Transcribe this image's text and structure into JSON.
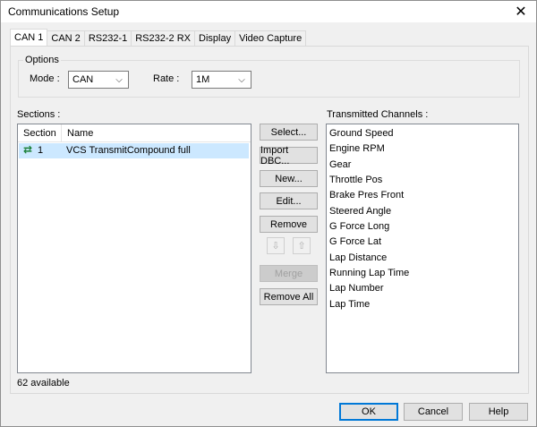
{
  "window": {
    "title": "Communications Setup",
    "close_glyph": "✕"
  },
  "tabs": [
    {
      "label": "CAN 1",
      "active": true
    },
    {
      "label": "CAN 2"
    },
    {
      "label": "RS232-1"
    },
    {
      "label": "RS232-2 RX"
    },
    {
      "label": "Display"
    },
    {
      "label": "Video Capture"
    }
  ],
  "options": {
    "legend": "Options",
    "mode_label": "Mode :",
    "mode_value": "CAN",
    "rate_label": "Rate :",
    "rate_value": "1M"
  },
  "sections": {
    "label": "Sections :",
    "columns": [
      "Section",
      "Name"
    ],
    "rows": [
      {
        "icon": "transmit-arrows-icon",
        "section": "1",
        "name": "VCS TransmitCompound full"
      }
    ],
    "footer": "62 available"
  },
  "actions": {
    "select": "Select...",
    "import": "Import DBC...",
    "new": "New...",
    "edit": "Edit...",
    "remove": "Remove",
    "move_down_glyph": "⇩",
    "move_up_glyph": "⇧",
    "merge": "Merge",
    "remove_all": "Remove All"
  },
  "channels": {
    "label": "Transmitted Channels :",
    "items": [
      "Ground Speed",
      "Engine RPM",
      "Gear",
      "Throttle Pos",
      "Brake Pres Front",
      "Steered Angle",
      "G Force Long",
      "G Force Lat",
      "Lap Distance",
      "Running Lap Time",
      "Lap Number",
      "Lap Time"
    ]
  },
  "dialog_buttons": {
    "ok": "OK",
    "cancel": "Cancel",
    "help": "Help"
  },
  "colors": {
    "selection": "#cce8ff",
    "default_button_border": "#0078d7",
    "transmit_icon": "#1a7f37"
  }
}
